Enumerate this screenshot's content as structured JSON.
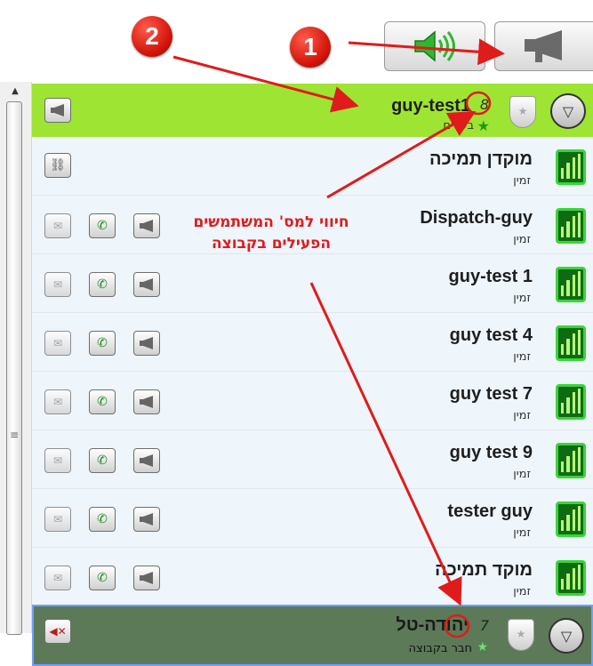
{
  "toolbar": {
    "speaker_icon": "speaker-on-icon",
    "megaphone_icon": "megaphone-icon"
  },
  "badges": {
    "one": "1",
    "two": "2"
  },
  "groups": [
    {
      "name": "guy-test1",
      "count": "8",
      "status": "בעלים"
    },
    {
      "name": "יהודה-טל",
      "count": "7",
      "status": "חבר בקבוצה"
    }
  ],
  "members": [
    {
      "name": "מוקדן תמיכה",
      "status": "זמין"
    },
    {
      "name": "Dispatch-guy",
      "status": "זמין"
    },
    {
      "name": "guy-test 1",
      "status": "זמין"
    },
    {
      "name": "guy test 4",
      "status": "זמין"
    },
    {
      "name": "guy test 7",
      "status": "זמין"
    },
    {
      "name": "guy test 9",
      "status": "זמין"
    },
    {
      "name": "tester guy",
      "status": "זמין"
    },
    {
      "name": "מוקד  תמיכה",
      "status": "זמין"
    }
  ],
  "annotation": "חיווי למס' המשתמשים הפעילים בקבוצה",
  "colors": {
    "active_group": "#9ee432",
    "muted_group": "#5c7a58",
    "annotation": "#e01b1b",
    "signal": "#0f6b12"
  }
}
